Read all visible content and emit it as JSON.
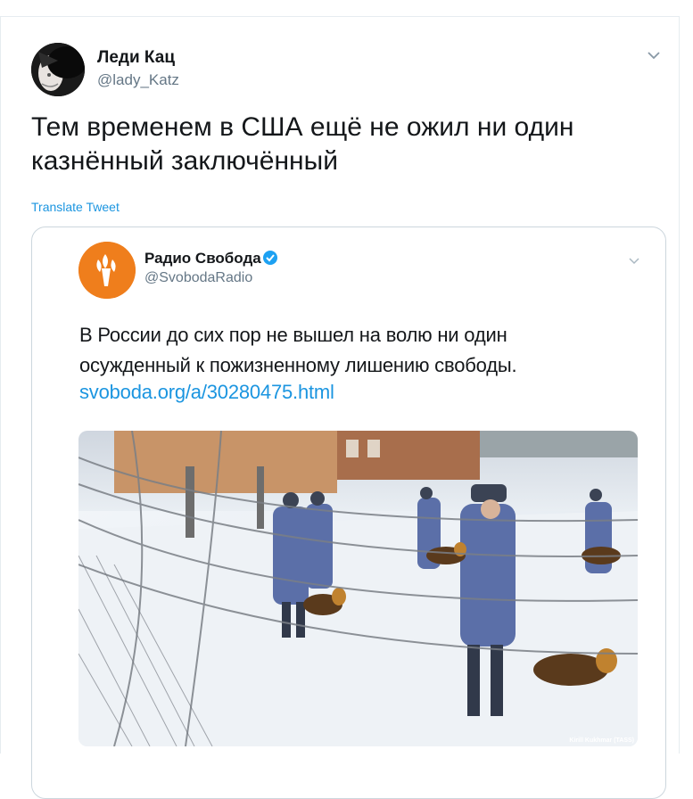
{
  "tweet": {
    "author_name": "Леди Кац",
    "author_handle": "@lady_Katz",
    "text": "Тем временем в США ещё не ожил ни один казнённый заключённый",
    "translate_label": "Translate Tweet"
  },
  "quoted_tweet": {
    "author_name": "Радио Свобода",
    "author_handle": "@SvobodaRadio",
    "text": "В России до сих пор не вышел на волю ни один осужденный к пожизненному лишению свободы.",
    "link": "svoboda.org/a/30280475.html",
    "photo_credit": "Kirill Kukhmar (TASS)"
  },
  "colors": {
    "link_blue": "#1b95e0",
    "secondary_text": "#657786",
    "border": "#ccd6dd",
    "brand_orange": "#ef7e1c"
  },
  "icons": [
    "chevron-down-icon",
    "verified-badge-icon",
    "radio-svoboda-logo"
  ]
}
